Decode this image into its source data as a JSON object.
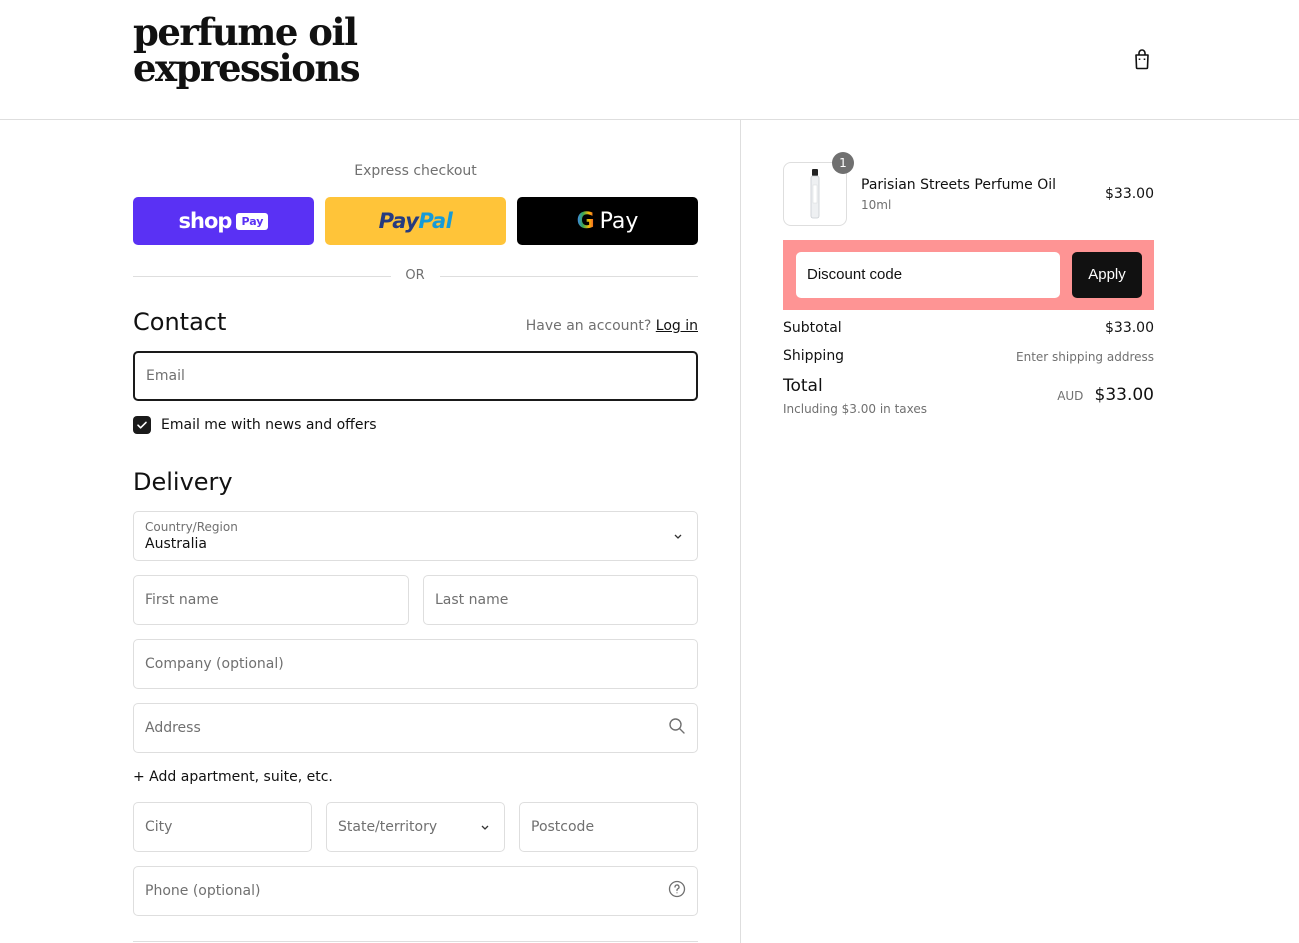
{
  "brand": {
    "line1": "perfume oil",
    "line2": "expressions"
  },
  "header": {
    "cart_icon": "shopping-bag-icon"
  },
  "express": {
    "title": "Express checkout",
    "shop_pay": {
      "word": "shop",
      "badge": "Pay"
    },
    "paypal": {
      "part1": "Pay",
      "part2": "Pal"
    },
    "gpay": {
      "g": "G",
      "word": "Pay"
    },
    "or": "OR"
  },
  "contact": {
    "title": "Contact",
    "account_prompt": "Have an account?",
    "login_label": "Log in",
    "email_placeholder": "Email",
    "newsletter_label": "Email me with news and offers",
    "newsletter_checked": true
  },
  "delivery": {
    "title": "Delivery",
    "country_label": "Country/Region",
    "country_value": "Australia",
    "first_name_placeholder": "First name",
    "last_name_placeholder": "Last name",
    "company_placeholder": "Company (optional)",
    "address_placeholder": "Address",
    "add_apartment_label": "+ Add apartment, suite, etc.",
    "city_placeholder": "City",
    "state_placeholder": "State/territory",
    "postcode_placeholder": "Postcode",
    "phone_placeholder": "Phone (optional)"
  },
  "summary": {
    "item": {
      "name": "Parisian Streets Perfume Oil",
      "variant": "10ml",
      "price": "$33.00",
      "quantity": "1"
    },
    "discount_placeholder": "Discount code",
    "apply_label": "Apply",
    "subtotal_label": "Subtotal",
    "subtotal_value": "$33.00",
    "shipping_label": "Shipping",
    "shipping_value": "Enter shipping address",
    "total_label": "Total",
    "tax_note": "Including $3.00 in taxes",
    "currency": "AUD",
    "total_value": "$33.00"
  },
  "colors": {
    "shop_pay": "#5a31f4",
    "paypal": "#ffc439",
    "gpay": "#000000",
    "discount_highlight": "#fe9494"
  }
}
